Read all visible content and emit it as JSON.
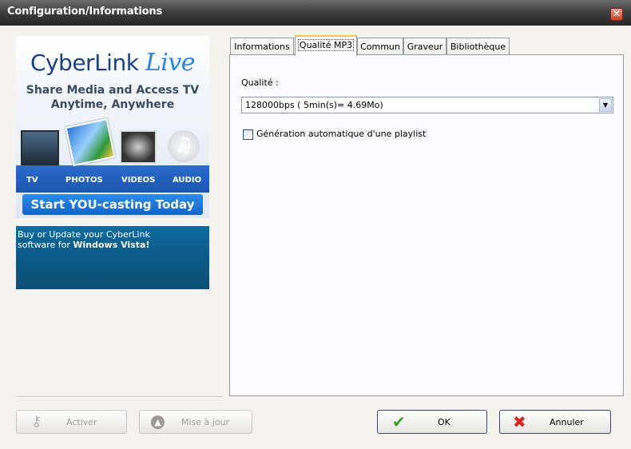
{
  "window": {
    "title": "Configuration/Informations",
    "close_glyph": "✕"
  },
  "ad": {
    "brand": "CyberLink",
    "brand_live": "Live",
    "tagline_line1": "Share Media and Access TV",
    "tagline_line2": "Anytime, Anywhere",
    "media_labels": [
      "TV",
      "PHOTOS",
      "VIDEOS",
      "AUDIO"
    ],
    "cta": "Start YOU-casting Today",
    "buy_line1": "Buy or Update your CyberLink",
    "buy_line2_prefix": "software for ",
    "buy_line2_bold": "Windows Vista!"
  },
  "tabs": [
    {
      "label": "Informations"
    },
    {
      "label": "Qualité MP3"
    },
    {
      "label": "Commun"
    },
    {
      "label": "Graveur"
    },
    {
      "label": "Bibliothèque"
    }
  ],
  "active_tab": "Qualité MP3",
  "mp3": {
    "quality_label": "Qualité :",
    "quality_value": "128000bps ( 5min(s)= 4.69Mo)",
    "playlist_label": "Génération automatique d'une playlist",
    "playlist_checked": false
  },
  "buttons": {
    "activer": "Activer",
    "mise_a_jour": "Mise à jour",
    "ok": "OK",
    "annuler": "Annuler"
  },
  "icons": {
    "key": "key-icon",
    "update": "update-arrow-icon",
    "ok": "checkmark-icon",
    "cancel": "x-icon"
  },
  "colors": {
    "titlebar": "#3f3f3f",
    "close": "#c8412c",
    "ad_blue": "#1d56ad",
    "ok_green": "#3aa12a",
    "cancel_red": "#d42a1c"
  }
}
